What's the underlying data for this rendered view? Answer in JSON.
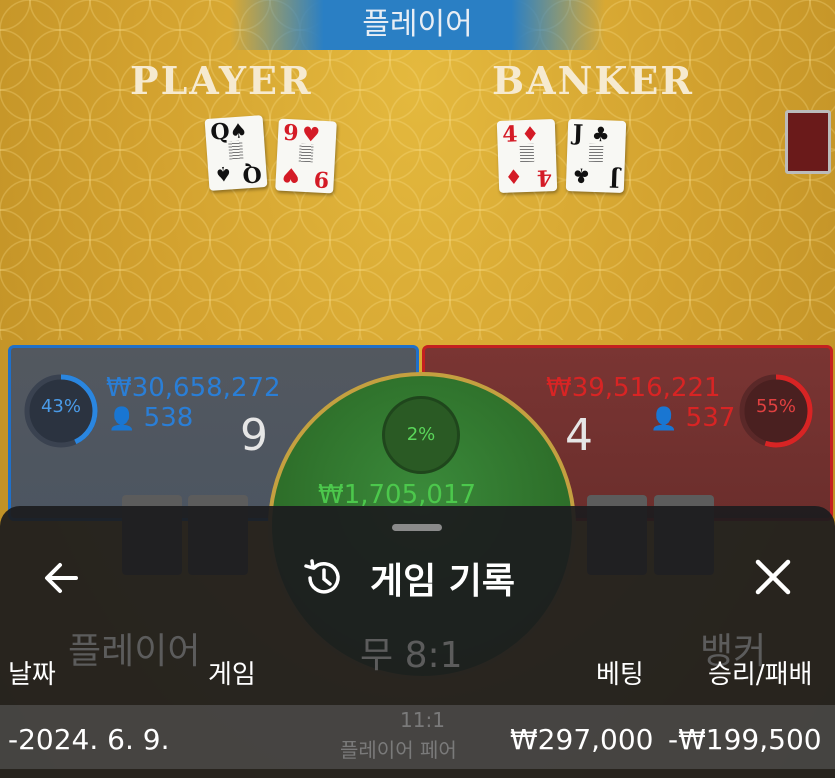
{
  "result_banner": "플레이어",
  "player": {
    "title": "PLAYER",
    "cards": [
      {
        "rank": "Q",
        "suit": "♠",
        "color": "black"
      },
      {
        "rank": "9",
        "suit": "♥",
        "color": "red"
      }
    ],
    "percent": "43%",
    "percent_value": 43,
    "amount": "₩30,658,272",
    "count": "538",
    "score": "9",
    "bet_label": "플레이어",
    "accent": "#1f70c9"
  },
  "banker": {
    "title": "BANKER",
    "cards": [
      {
        "rank": "4",
        "suit": "♦",
        "color": "red"
      },
      {
        "rank": "J",
        "suit": "♣",
        "color": "black"
      }
    ],
    "percent": "55%",
    "percent_value": 55,
    "amount": "₩39,516,221",
    "count": "537",
    "score": "4",
    "bet_label": "뱅커",
    "accent": "#c32020"
  },
  "tie": {
    "percent": "2%",
    "amount": "₩1,705,017",
    "label": "무 8:1",
    "sub_label": "11:1",
    "sub_caption": "플레이어 페어"
  },
  "history_sheet": {
    "title": "게임 기록",
    "back_icon": "arrow-left-icon",
    "history_icon": "history-icon",
    "close_icon": "close-icon",
    "columns": {
      "date": "날짜",
      "game": "게임",
      "bet": "베팅",
      "result": "승리/패배"
    },
    "rows": [
      {
        "date": "-2024. 6. 9.",
        "game": "",
        "bet": "₩297,000",
        "result": "-₩199,500"
      }
    ]
  }
}
